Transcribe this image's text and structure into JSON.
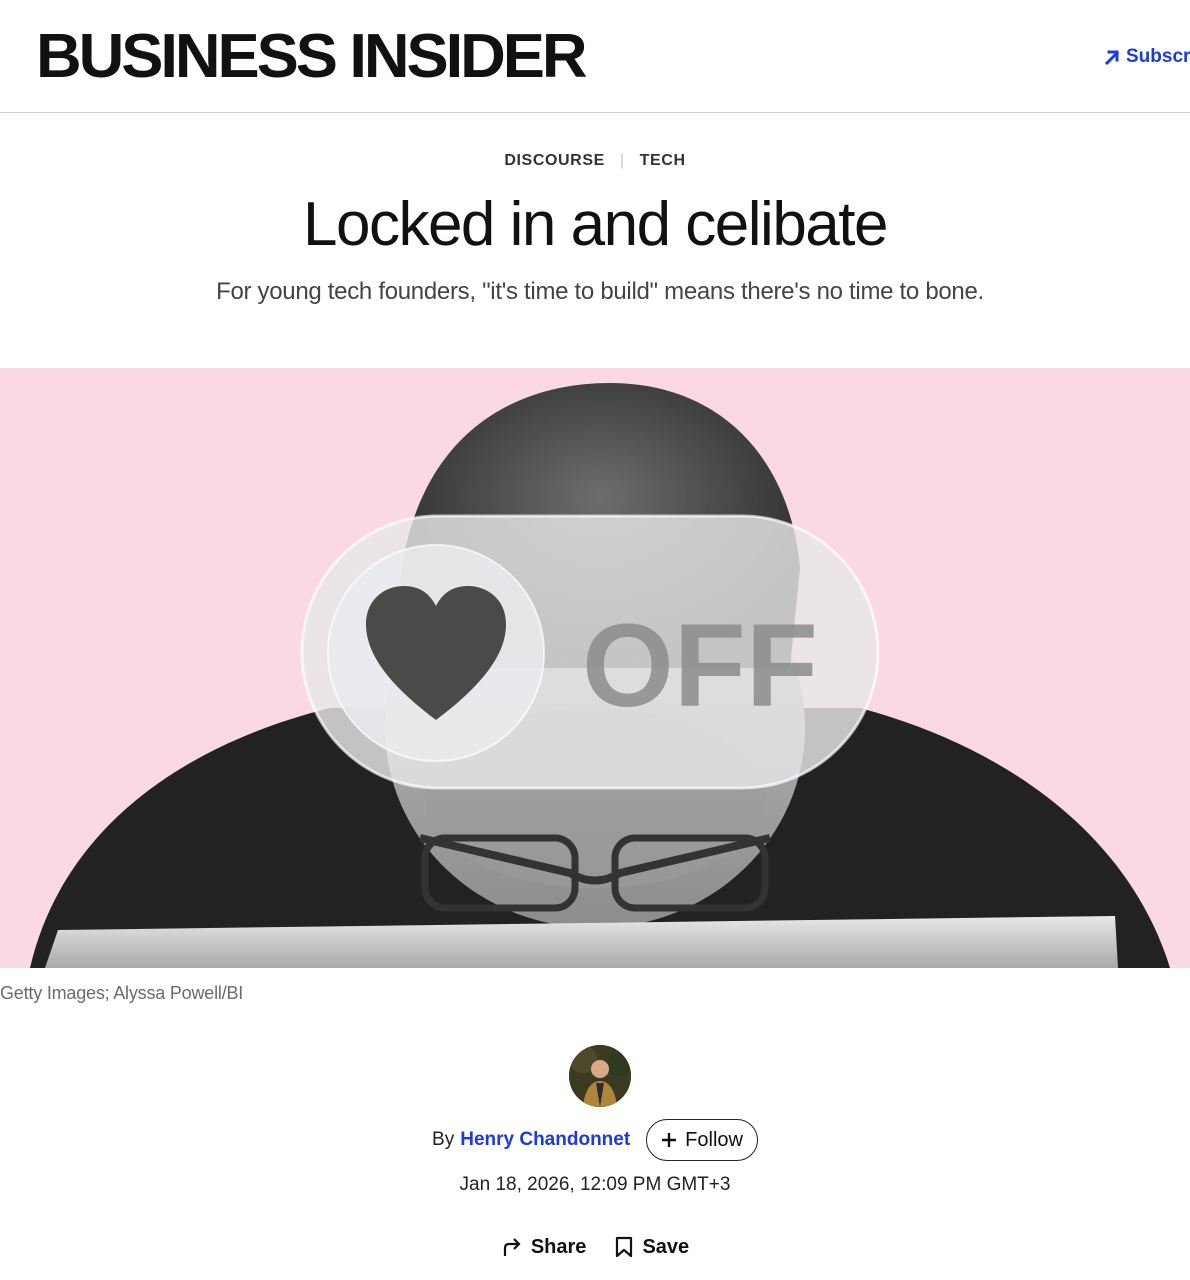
{
  "header": {
    "logo": "BUSINESS INSIDER",
    "subscribe_label": "Subscribe",
    "accent_color": "#1a3ae6"
  },
  "article": {
    "categories": [
      "DISCOURSE",
      "TECH"
    ],
    "headline": "Locked in and celibate",
    "dek": "For young tech founders, \"it's time to build\" means there's no time to bone.",
    "hero": {
      "toggle_label": "OFF",
      "caption": "Getty Images; Alyssa Powell/BI",
      "background_color": "#fbd9e4"
    },
    "byline": {
      "prefix": "By",
      "author": "Henry Chandonnet",
      "follow_label": "Follow"
    },
    "date": "Jan 18, 2026, 12:09 PM GMT+3",
    "actions": {
      "share_label": "Share",
      "save_label": "Save"
    }
  }
}
